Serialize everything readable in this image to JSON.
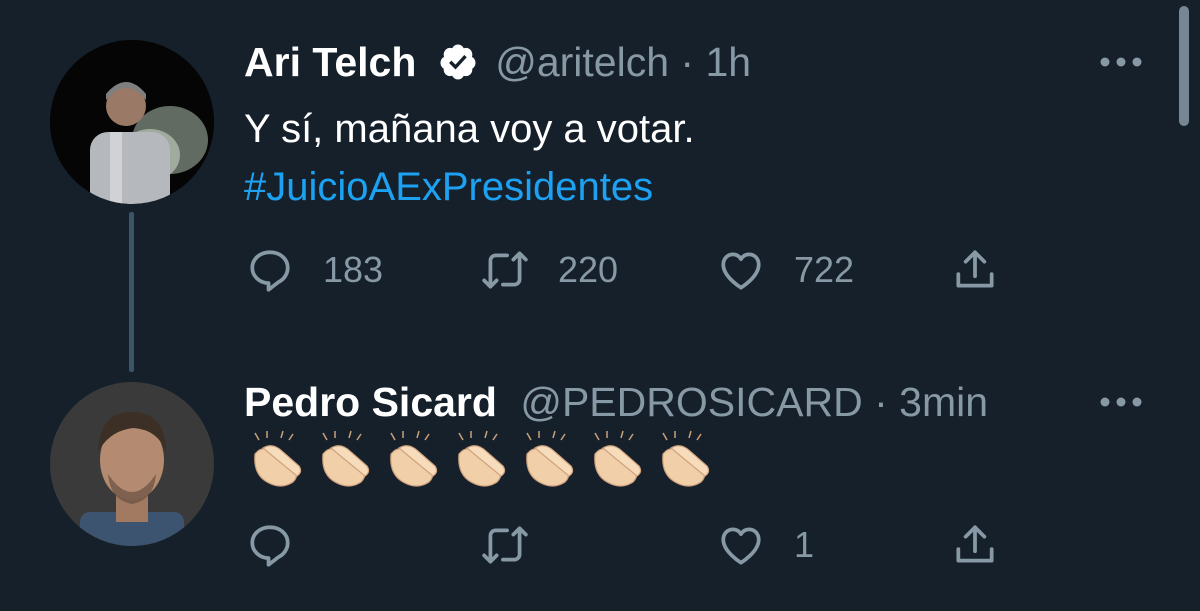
{
  "tweets": [
    {
      "name": "Ari Telch",
      "handle": "@aritelch",
      "separator": "·",
      "time": "1h",
      "verified": true,
      "text": "Y sí, mañana voy a votar.",
      "hashtag": "#JuicioAExPresidentes",
      "replies": "183",
      "retweets": "220",
      "likes": "722"
    },
    {
      "name": "Pedro Sicard",
      "handle": "@PEDROSICARD",
      "separator": "·",
      "time": "3min",
      "verified": false,
      "emoji_count": 7,
      "emoji": "clapping-hands",
      "replies": "",
      "retweets": "",
      "likes": "1"
    }
  ],
  "colors": {
    "background": "#15202b",
    "text": "#ffffff",
    "muted": "#8899a6",
    "link": "#1da1f2"
  },
  "icons": [
    "verified-badge-icon",
    "more-icon",
    "reply-icon",
    "retweet-icon",
    "like-icon",
    "share-icon"
  ]
}
